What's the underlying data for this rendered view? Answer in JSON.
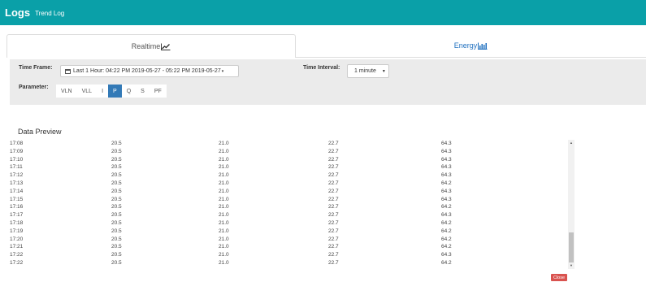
{
  "header": {
    "title": "Logs",
    "subtitle": "Trend Log"
  },
  "tabs": [
    {
      "label": "Realtime",
      "icon": "line-chart-icon"
    },
    {
      "label": "Energy",
      "icon": "bar-chart-icon"
    }
  ],
  "filters": {
    "time_frame_label": "Time Frame:",
    "time_frame_value": "Last 1 Hour: 04:22 PM 2019-05-27 - 05:22 PM 2019-05-27",
    "time_interval_label": "Time Interval:",
    "time_interval_value": "1 minute",
    "parameter_label": "Parameter:",
    "parameters": [
      "VLN",
      "VLL",
      "I",
      "P",
      "Q",
      "S",
      "PF"
    ],
    "active_parameter": "P"
  },
  "preview": {
    "title": "Data Preview",
    "rows": [
      [
        "17:08",
        "20.5",
        "21.0",
        "22.7",
        "64.3"
      ],
      [
        "17:09",
        "20.5",
        "21.0",
        "22.7",
        "64.3"
      ],
      [
        "17:10",
        "20.5",
        "21.0",
        "22.7",
        "64.3"
      ],
      [
        "17:11",
        "20.5",
        "21.0",
        "22.7",
        "64.3"
      ],
      [
        "17:12",
        "20.5",
        "21.0",
        "22.7",
        "64.3"
      ],
      [
        "17:13",
        "20.5",
        "21.0",
        "22.7",
        "64.2"
      ],
      [
        "17:14",
        "20.5",
        "21.0",
        "22.7",
        "64.3"
      ],
      [
        "17:15",
        "20.5",
        "21.0",
        "22.7",
        "64.3"
      ],
      [
        "17:16",
        "20.5",
        "21.0",
        "22.7",
        "64.2"
      ],
      [
        "17:17",
        "20.5",
        "21.0",
        "22.7",
        "64.3"
      ],
      [
        "17:18",
        "20.5",
        "21.0",
        "22.7",
        "64.2"
      ],
      [
        "17:19",
        "20.5",
        "21.0",
        "22.7",
        "64.2"
      ],
      [
        "17:20",
        "20.5",
        "21.0",
        "22.7",
        "64.2"
      ],
      [
        "17:21",
        "20.5",
        "21.0",
        "22.7",
        "64.2"
      ],
      [
        "17:22",
        "20.5",
        "21.0",
        "22.7",
        "64.3"
      ],
      [
        "17:22",
        "20.5",
        "21.0",
        "22.7",
        "64.2"
      ]
    ]
  },
  "close_label": "Close",
  "colors": {
    "header_bg": "#0aa0a8",
    "active_param": "#337ab7",
    "energy_tab": "#1e6fbf",
    "close_button": "#d9534f"
  }
}
